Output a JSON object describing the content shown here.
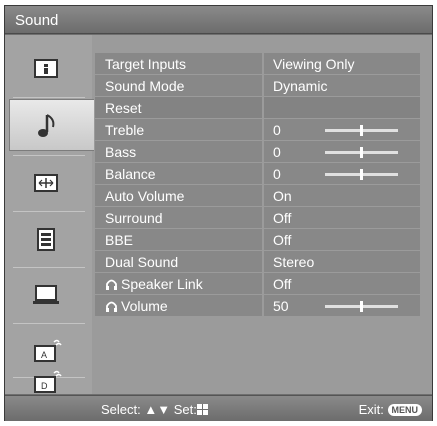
{
  "window": {
    "title": "Sound"
  },
  "sidebar": {
    "items": [
      {
        "icon": "info-icon",
        "active": false
      },
      {
        "icon": "music-note-icon",
        "active": true
      },
      {
        "icon": "screen-adjust-icon",
        "active": false
      },
      {
        "icon": "setup-list-icon",
        "active": false
      },
      {
        "icon": "monitor-icon",
        "active": false
      },
      {
        "icon": "analog-channel-icon",
        "active": false
      },
      {
        "icon": "digital-channel-icon",
        "active": false
      }
    ]
  },
  "settings": {
    "rows": [
      {
        "label": "Target Inputs",
        "value": "Viewing Only"
      },
      {
        "label": "Sound Mode",
        "value": "Dynamic"
      },
      {
        "label": "Reset",
        "value": ""
      },
      {
        "label": "Treble",
        "value": "0",
        "slider_fraction": 0.5
      },
      {
        "label": "Bass",
        "value": "0",
        "slider_fraction": 0.5
      },
      {
        "label": "Balance",
        "value": "0",
        "slider_fraction": 0.5
      },
      {
        "label": "Auto Volume",
        "value": "On"
      },
      {
        "label": "Surround",
        "value": "Off"
      },
      {
        "label": "BBE",
        "value": "Off"
      },
      {
        "label": "Dual Sound",
        "value": "Stereo"
      },
      {
        "label": "Speaker Link",
        "value": "Off",
        "headphone_icon": true
      },
      {
        "label": "Volume",
        "value": "50",
        "headphone_icon": true,
        "slider_fraction": 0.5
      }
    ]
  },
  "footer": {
    "select_label": "Select:",
    "set_label": "Set:",
    "exit_label": "Exit:",
    "menu_key": "MENU"
  }
}
